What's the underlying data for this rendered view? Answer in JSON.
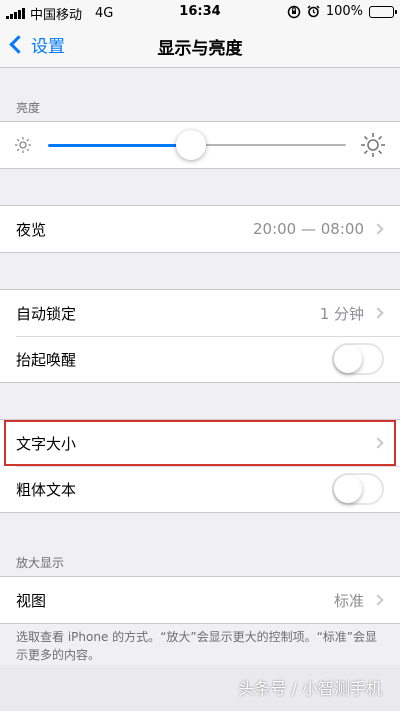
{
  "status_bar": {
    "carrier": "中国移动",
    "network": "4G",
    "time": "16:34",
    "battery": "100%"
  },
  "nav": {
    "back_label": "设置",
    "title": "显示与亮度"
  },
  "brightness": {
    "section_label": "亮度",
    "level": 0.48
  },
  "night_shift": {
    "label": "夜览",
    "value": "20:00 — 08:00"
  },
  "lock": {
    "auto_lock_label": "自动锁定",
    "auto_lock_value": "1 分钟",
    "raise_to_wake_label": "抬起唤醒",
    "raise_to_wake_on": false
  },
  "text": {
    "text_size_label": "文字大小",
    "bold_text_label": "粗体文本",
    "bold_text_on": false
  },
  "zoom": {
    "section_label": "放大显示",
    "view_label": "视图",
    "view_value": "标准",
    "footnote": "选取查看 iPhone 的方式。“放大”会显示更大的控制项。“标准”会显示更多的内容。"
  },
  "watermark": "头条号 / 小智测手机",
  "colors": {
    "accent": "#007aff",
    "highlight": "#d0342c",
    "background": "#efeff4"
  }
}
